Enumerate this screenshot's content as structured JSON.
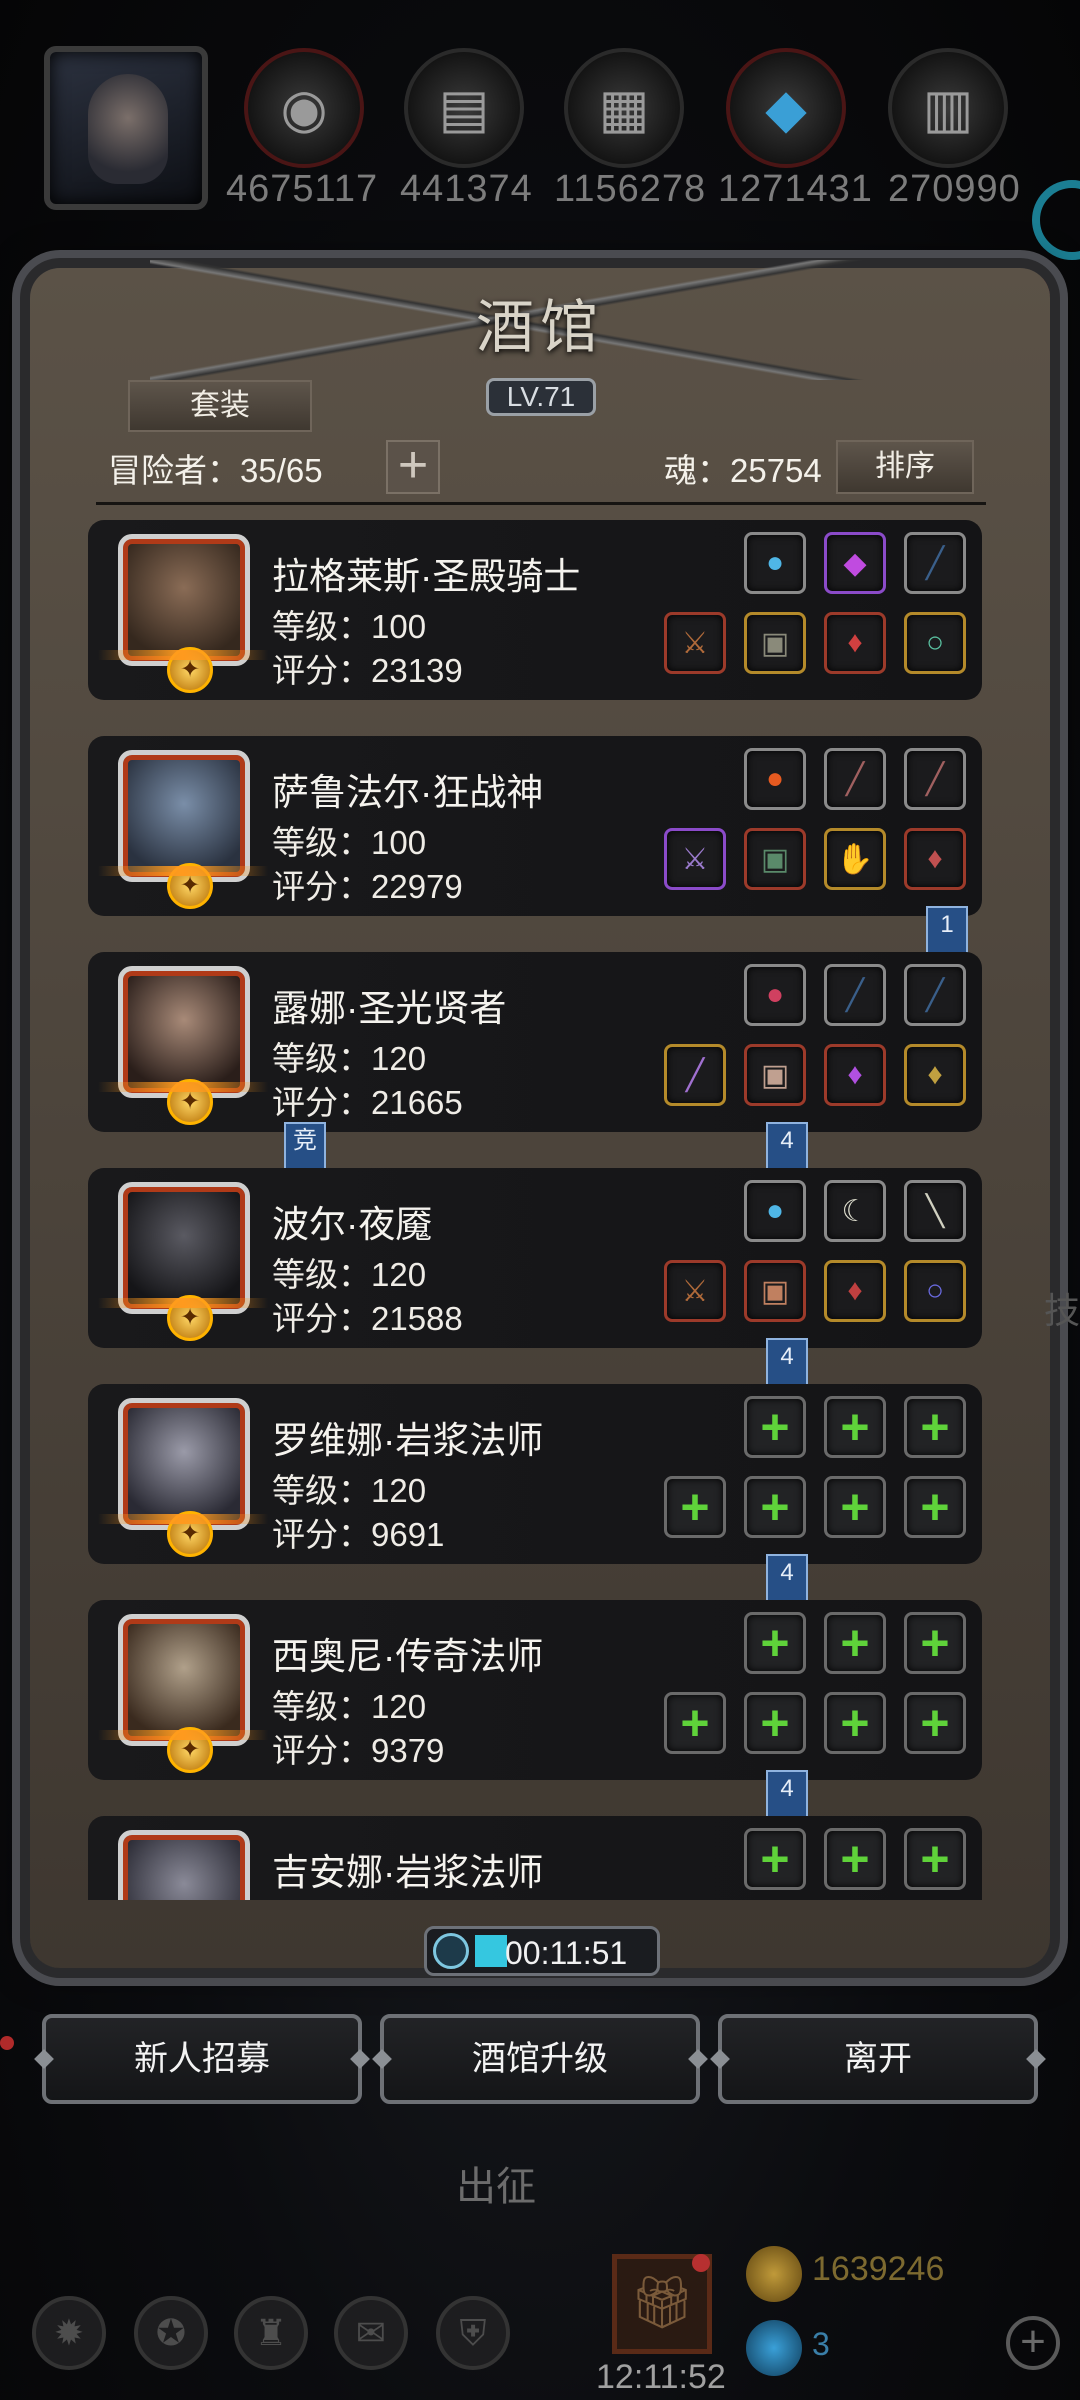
{
  "resources": [
    {
      "icon": "ore-icon",
      "value": "4675117"
    },
    {
      "icon": "wood-icon",
      "value": "441374"
    },
    {
      "icon": "iron-icon",
      "value": "1156278"
    },
    {
      "icon": "crystal-icon",
      "value": "1271431"
    },
    {
      "icon": "steel-icon",
      "value": "270990"
    }
  ],
  "tavern": {
    "title": "酒馆",
    "level": "LV.71",
    "suit_button": "套装",
    "adventurers_label": "冒险者：35/65",
    "add_icon": "plus-icon",
    "soul_label": "魂：25754",
    "sort_button": "排序"
  },
  "heroes": [
    {
      "name": "拉格莱斯·圣殿骑士",
      "level": "等级：100",
      "score": "评分：23139",
      "ribbon": ""
    },
    {
      "name": "萨鲁法尔·狂战神",
      "level": "等级：100",
      "score": "评分：22979",
      "ribbon": "1"
    },
    {
      "name": "露娜·圣光贤者",
      "level": "等级：120",
      "score": "评分：21665",
      "ribbon": "4",
      "badge": "竞"
    },
    {
      "name": "波尔·夜魇",
      "level": "等级：120",
      "score": "评分：21588",
      "ribbon": "4"
    },
    {
      "name": "罗维娜·岩浆法师",
      "level": "等级：120",
      "score": "评分：9691",
      "ribbon": "4"
    },
    {
      "name": "西奥尼·传奇法师",
      "level": "等级：120",
      "score": "评分：9379",
      "ribbon": "4"
    },
    {
      "name": "吉安娜·岩浆法师",
      "level": "",
      "score": "",
      "ribbon": ""
    }
  ],
  "timer": "00:11:51",
  "buttons": {
    "recruit": "新人招募",
    "upgrade": "酒馆升级",
    "leave": "离开"
  },
  "background": {
    "expedition": "出征",
    "clock": "12:11:52",
    "gold": "1639246",
    "gems": "3",
    "side_text": "技"
  },
  "colors": {
    "accent_cyan": "#35c7e0",
    "plus_green": "#5fd23a",
    "ribbon_blue": "#264f86",
    "frame_orange": "#b03a18"
  }
}
